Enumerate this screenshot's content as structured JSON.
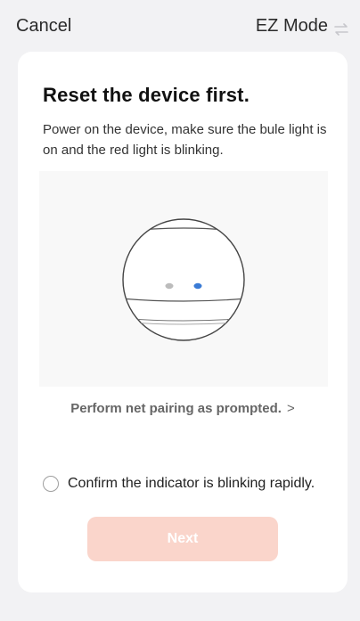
{
  "header": {
    "cancel_label": "Cancel",
    "mode_label": "EZ Mode",
    "mode_icon": "switch-arrows-icon"
  },
  "card": {
    "title": "Reset the device first.",
    "description": "Power on the device, make sure the bule light is on and the red light is blinking.",
    "prompt_label": "Perform net pairing as prompted.",
    "prompt_chevron": ">",
    "confirm_label": "Confirm the indicator is blinking rapidly.",
    "confirm_checked": false,
    "next_label": "Next",
    "next_enabled": false
  },
  "illustration": {
    "left_light_color": "#bcbcbc",
    "right_light_color": "#3a7bd5"
  },
  "colors": {
    "next_button_bg": "#fad5cb",
    "page_bg": "#f2f2f4"
  }
}
